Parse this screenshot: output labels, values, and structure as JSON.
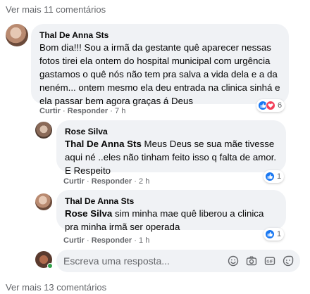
{
  "more_comments_top": "Ver mais 11 comentários",
  "more_comments_bottom": "Ver mais 13 comentários",
  "comments": [
    {
      "author": "Thal De Anna Sts",
      "text": "Bom dia!!! Sou a irmã da gestante quê aparecer nessas fotos tirei ela ontem do hospital municipal com urgência gastamos o quê nós não tem pra salva a vida dela e a da neném... ontem mesmo ela deu entrada na clinica sinhá e ela passar bem agora graças á Deus",
      "like_label": "Curtir",
      "reply_label": "Responder",
      "time": "7 h",
      "reaction_count": "6"
    },
    {
      "author": "Rose Silva",
      "mention": "Thal De Anna Sts",
      "text": " Meus Deus se sua mãe tivesse aqui né ..eles não tinham feito isso q falta de amor. E Respeito",
      "like_label": "Curtir",
      "reply_label": "Responder",
      "time": "2 h",
      "reaction_count": "1"
    },
    {
      "author": "Thal De Anna Sts",
      "mention": "Rose Silva",
      "text": " sim minha mae quê liberou a clinica pra minha irmã ser operada",
      "like_label": "Curtir",
      "reply_label": "Responder",
      "time": "1 h",
      "reaction_count": "1"
    }
  ],
  "reply_box": {
    "placeholder": "Escreva uma resposta..."
  },
  "icons": [
    "smiley-icon",
    "camera-icon",
    "gif-icon",
    "sticker-icon",
    "like-reaction-icon",
    "love-reaction-icon"
  ],
  "colors": {
    "like": "#1877f2",
    "love": "#f33e58",
    "online": "#31a24c"
  }
}
